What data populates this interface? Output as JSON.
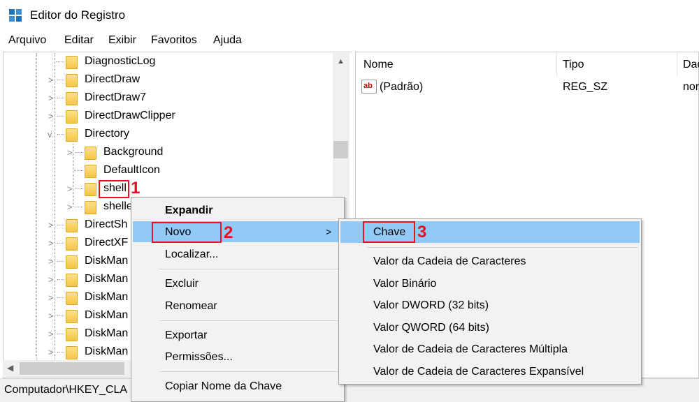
{
  "window": {
    "title": "Editor do Registro",
    "icon": "registry-editor-icon"
  },
  "menubar": [
    "Arquivo",
    "Editar",
    "Exibir",
    "Favoritos",
    "Ajuda"
  ],
  "tree": [
    {
      "label": "DiagnosticLog",
      "expander": ""
    },
    {
      "label": "DirectDraw",
      "expander": ">"
    },
    {
      "label": "DirectDraw7",
      "expander": ">"
    },
    {
      "label": "DirectDrawClipper",
      "expander": ">"
    },
    {
      "label": "Directory",
      "expander": "v"
    },
    {
      "label": "Background",
      "expander": ">"
    },
    {
      "label": "DefaultIcon",
      "expander": ""
    },
    {
      "label": "shell",
      "expander": ">"
    },
    {
      "label": "shelle",
      "expander": ">"
    },
    {
      "label": "DirectSh",
      "expander": ">"
    },
    {
      "label": "DirectXF",
      "expander": ">"
    },
    {
      "label": "DiskMan",
      "expander": ">"
    },
    {
      "label": "DiskMan",
      "expander": ">"
    },
    {
      "label": "DiskMan",
      "expander": ">"
    },
    {
      "label": "DiskMan",
      "expander": ">"
    },
    {
      "label": "DiskMan",
      "expander": ">"
    },
    {
      "label": "DiskMan",
      "expander": ">"
    }
  ],
  "list": {
    "columns": [
      "Nome",
      "Tipo",
      "Dad"
    ],
    "rows": [
      {
        "name": "(Padrão)",
        "type": "REG_SZ",
        "data": "nor"
      }
    ]
  },
  "status": "Computador\\HKEY_CLA",
  "context_menu": {
    "items": [
      "Expandir",
      "Novo",
      "Localizar...",
      "Excluir",
      "Renomear",
      "Exportar",
      "Permissões...",
      "Copiar Nome da Chave"
    ],
    "submenu_arrow": ">"
  },
  "submenu": {
    "items": [
      "Chave",
      "Valor da Cadeia de Caracteres",
      "Valor Binário",
      "Valor DWORD (32 bits)",
      "Valor QWORD (64 bits)",
      "Valor de Cadeia de Caracteres Múltipla",
      "Valor de Cadeia de Caracteres Expansível"
    ]
  },
  "annotations": [
    "1",
    "2",
    "3"
  ],
  "colors": {
    "highlight_border": "#e81123",
    "menu_hover": "#91c9f7",
    "folder": "#f5c645"
  }
}
